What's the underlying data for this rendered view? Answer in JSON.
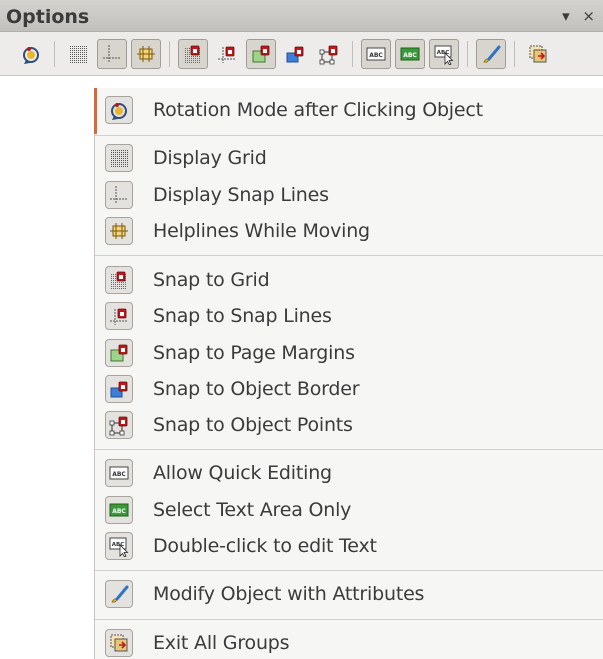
{
  "toolbar": {
    "title": "Options",
    "dropdown_glyph": "▾",
    "close_glyph": "×",
    "buttons": [
      {
        "icon": "rotation-mode-icon",
        "pressed": false
      },
      {
        "icon": "display-grid-icon",
        "pressed": false
      },
      {
        "icon": "display-snap-lines-icon",
        "pressed": true
      },
      {
        "icon": "helplines-while-moving-icon",
        "pressed": true
      },
      {
        "icon": "snap-to-grid-icon",
        "pressed": true
      },
      {
        "icon": "snap-to-snap-lines-icon",
        "pressed": false
      },
      {
        "icon": "snap-to-page-margins-icon",
        "pressed": true
      },
      {
        "icon": "snap-to-object-border-icon",
        "pressed": false
      },
      {
        "icon": "snap-to-object-points-icon",
        "pressed": false
      },
      {
        "icon": "allow-quick-editing-icon",
        "pressed": true
      },
      {
        "icon": "select-text-area-only-icon",
        "pressed": true
      },
      {
        "icon": "double-click-edit-text-icon",
        "pressed": true
      },
      {
        "icon": "modify-object-with-attributes-icon",
        "pressed": true
      },
      {
        "icon": "exit-all-groups-icon",
        "pressed": false
      }
    ]
  },
  "menu": {
    "items": [
      {
        "label": "Rotation Mode after Clicking Object",
        "icon": "rotation-mode-icon"
      },
      {
        "label": "Display Grid",
        "icon": "display-grid-icon"
      },
      {
        "label": "Display Snap Lines",
        "icon": "display-snap-lines-icon"
      },
      {
        "label": "Helplines While Moving",
        "icon": "helplines-while-moving-icon"
      },
      {
        "label": "Snap to Grid",
        "icon": "snap-to-grid-icon"
      },
      {
        "label": "Snap to Snap Lines",
        "icon": "snap-to-snap-lines-icon"
      },
      {
        "label": "Snap to Page Margins",
        "icon": "snap-to-page-margins-icon"
      },
      {
        "label": "Snap to Object Border",
        "icon": "snap-to-object-border-icon"
      },
      {
        "label": "Snap to Object Points",
        "icon": "snap-to-object-points-icon"
      },
      {
        "label": "Allow Quick Editing",
        "icon": "allow-quick-editing-icon"
      },
      {
        "label": "Select Text Area Only",
        "icon": "select-text-area-only-icon"
      },
      {
        "label": "Double-click to edit Text",
        "icon": "double-click-edit-text-icon"
      },
      {
        "label": "Modify Object with Attributes",
        "icon": "modify-object-with-attributes-icon"
      },
      {
        "label": "Exit All Groups",
        "icon": "exit-all-groups-icon"
      }
    ],
    "icon_text": "ABC"
  },
  "colors": {
    "snap_red": "#c0171b",
    "accent": "#d7683b",
    "text": "#3b3b3b",
    "page_blue": "#3f7ed6",
    "text_green": "#3a9a3a",
    "paint_blue": "#2e73c4",
    "paint_yellow": "#e8b72b"
  }
}
